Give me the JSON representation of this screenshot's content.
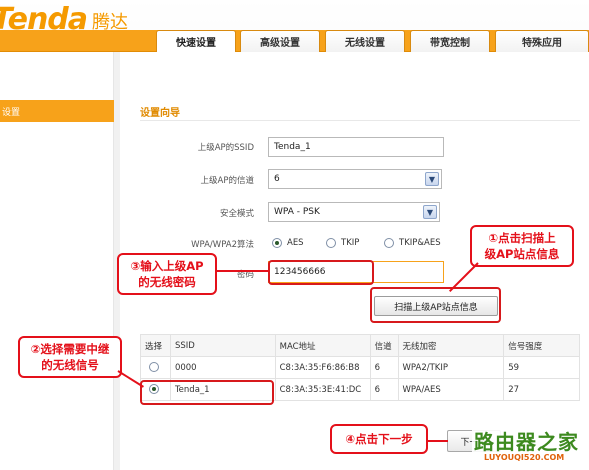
{
  "header": {
    "logo_text": "Tenda",
    "logo_cn": "腾达",
    "tabs": [
      "快速设置",
      "高级设置",
      "无线设置",
      "带宽控制",
      "特殊应用"
    ]
  },
  "sidebar": {
    "active_item": "设置"
  },
  "main": {
    "section_title": "设置向导",
    "form": {
      "ssid_label": "上级AP的SSID",
      "ssid_value": "Tenda_1",
      "channel_label": "上级AP的信道",
      "channel_value": "6",
      "security_label": "安全模式",
      "security_value": "WPA - PSK",
      "algo_label": "WPA/WPA2算法",
      "algo_options": [
        "AES",
        "TKIP",
        "TKIP&AES"
      ],
      "algo_selected": "AES",
      "password_label": "密码",
      "password_value": "123456666"
    },
    "scan_button": "扫描上级AP站点信息",
    "table": {
      "headers": [
        "选择",
        "SSID",
        "MAC地址",
        "信道",
        "无线加密",
        "信号强度"
      ],
      "rows": [
        {
          "ssid": "0000",
          "mac": "C8:3A:35:F6:86:B8",
          "channel": "6",
          "encryption": "WPA2/TKIP",
          "signal": "59",
          "selected": false
        },
        {
          "ssid": "Tenda_1",
          "mac": "C8:3A:35:3E:41:DC",
          "channel": "6",
          "encryption": "WPA/AES",
          "signal": "27",
          "selected": true
        }
      ]
    },
    "next_button": "下一步"
  },
  "annotations": {
    "step1": "①点击扫描上级AP站点信息",
    "step1_line1": "①点击扫描上",
    "step1_line2": "级AP站点信息",
    "step2_line1": "②选择需要中继",
    "step2_line2": "的无线信号",
    "step3_line1": "③输入上级AP",
    "step3_line2": "的无线密码",
    "step4": "④点击下一步"
  },
  "watermark": {
    "cn": "路由器之家",
    "en": "LUYOUQI520.COM"
  },
  "colors": {
    "brand_orange": "#f7a21a",
    "annotation_red": "#e4101a"
  }
}
